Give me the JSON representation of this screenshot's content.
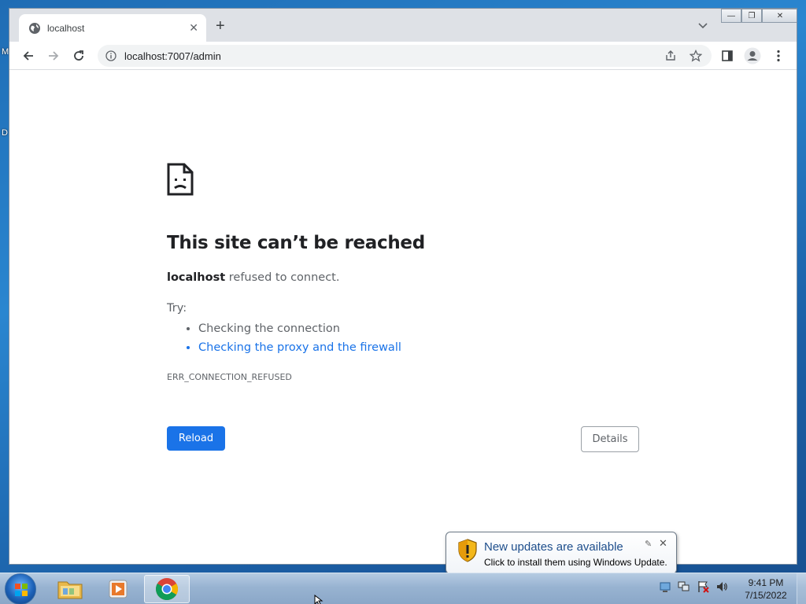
{
  "desktop": {
    "labels": [
      "M",
      "D"
    ]
  },
  "browser": {
    "tab": {
      "title": "localhost",
      "close_glyph": "✕"
    },
    "new_tab_glyph": "+",
    "window_controls": {
      "minimize": "—",
      "maximize": "❐",
      "close": "✕"
    },
    "address": {
      "url": "localhost:7007/admin"
    }
  },
  "error": {
    "title": "This site can’t be reached",
    "host": "localhost",
    "description_rest": " refused to connect.",
    "try_label": "Try:",
    "suggestions": [
      "Checking the connection",
      "Checking the proxy and the firewall"
    ],
    "code": "ERR_CONNECTION_REFUSED",
    "reload_label": "Reload",
    "details_label": "Details"
  },
  "notification": {
    "title": "New updates are available",
    "body": "Click to install them using Windows Update.",
    "close_glyph": "✕",
    "pin_glyph": "✎"
  },
  "taskbar": {
    "clock": {
      "time": "9:41 PM",
      "date": "7/15/2022"
    }
  },
  "colors": {
    "link": "#1a73e8",
    "reload_bg": "#1a73e8",
    "notif_title": "#1e4e8c"
  }
}
